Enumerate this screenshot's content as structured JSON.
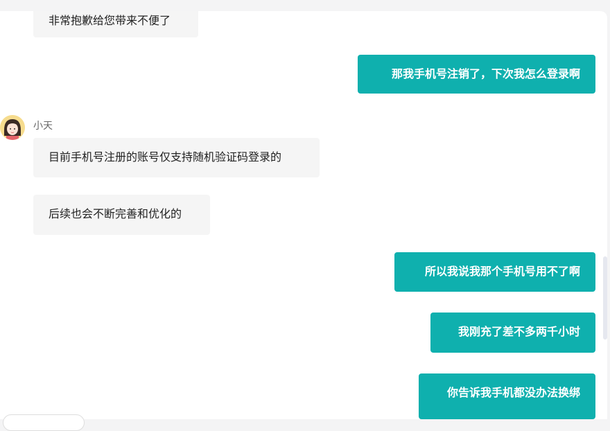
{
  "chat": {
    "agent_name": "小天",
    "messages": [
      {
        "side": "left",
        "text": "非常抱歉给您带来不便了"
      },
      {
        "side": "right",
        "text": "那我手机号注销了，下次我怎么登录啊"
      },
      {
        "side": "left",
        "text": "目前手机号注册的账号仅支持随机验证码登录的"
      },
      {
        "side": "left",
        "text": "后续也会不断完善和优化的"
      },
      {
        "side": "right",
        "text": "所以我说我那个手机号用不了啊"
      },
      {
        "side": "right",
        "text": "我刚充了差不多两千小时"
      },
      {
        "side": "right",
        "text": "你告诉我手机都没办法换绑"
      }
    ]
  },
  "colors": {
    "user_bubble": "#0fb0ae",
    "agent_bubble": "#f5f5f5",
    "avatar_bg": "#f6dc8e"
  }
}
